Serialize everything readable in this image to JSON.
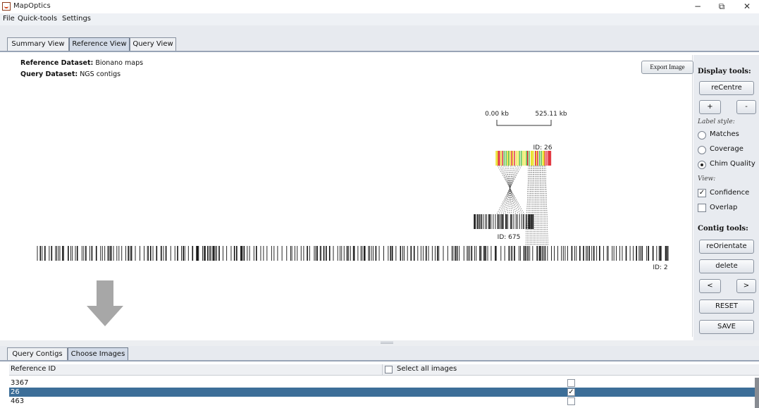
{
  "window": {
    "title": "MapOptics",
    "minimize": "−",
    "restore": "⧉",
    "close": "✕"
  },
  "menu": [
    "File",
    "Quick-tools",
    "Settings"
  ],
  "main_tabs": [
    {
      "label": "Summary View",
      "active": false
    },
    {
      "label": "Reference View",
      "active": true
    },
    {
      "label": "Query View",
      "active": false
    }
  ],
  "canvas": {
    "reference_dataset_label": "Reference Dataset:",
    "reference_dataset_value": "Bionano maps",
    "query_dataset_label": "Query Dataset:",
    "query_dataset_value": "NGS contigs",
    "export_label": "Export Image",
    "scale": {
      "start": "0.00 kb",
      "end": "525.11 kb"
    },
    "contig_top_id": "ID: 26",
    "contig_left_id": "ID: 675",
    "reference_id": "ID: 2"
  },
  "tools": {
    "display_heading": "Display tools:",
    "recentre": "reCentre",
    "zoom_in": "+",
    "zoom_out": "-",
    "label_style_heading": "Label style:",
    "label_options": [
      {
        "label": "Matches",
        "selected": false
      },
      {
        "label": "Coverage",
        "selected": false
      },
      {
        "label": "Chim Quality",
        "selected": true
      }
    ],
    "view_heading": "View:",
    "view_options": [
      {
        "label": "Confidence",
        "checked": true
      },
      {
        "label": "Overlap",
        "checked": false
      }
    ],
    "contig_heading": "Contig tools:",
    "reorientate": "reOrientate",
    "delete": "delete",
    "prev": "<",
    "next": ">",
    "reset": "RESET",
    "save": "SAVE"
  },
  "bottom_tabs": [
    {
      "label": "Query Contigs",
      "active": false
    },
    {
      "label": "Choose Images",
      "active": true
    }
  ],
  "table": {
    "col_reference_id": "Reference ID",
    "select_all_label": "Select all images",
    "rows": [
      {
        "id": "3367",
        "checked": false,
        "selected": false
      },
      {
        "id": "26",
        "checked": true,
        "selected": true
      },
      {
        "id": "463",
        "checked": false,
        "selected": false
      }
    ]
  },
  "colors": {
    "selected_row": "#3c6e98",
    "quality_red": "#e0202a",
    "quality_yellow": "#e8e020",
    "quality_green": "#4fb83a",
    "arrow_gray": "#a7a7a7"
  }
}
